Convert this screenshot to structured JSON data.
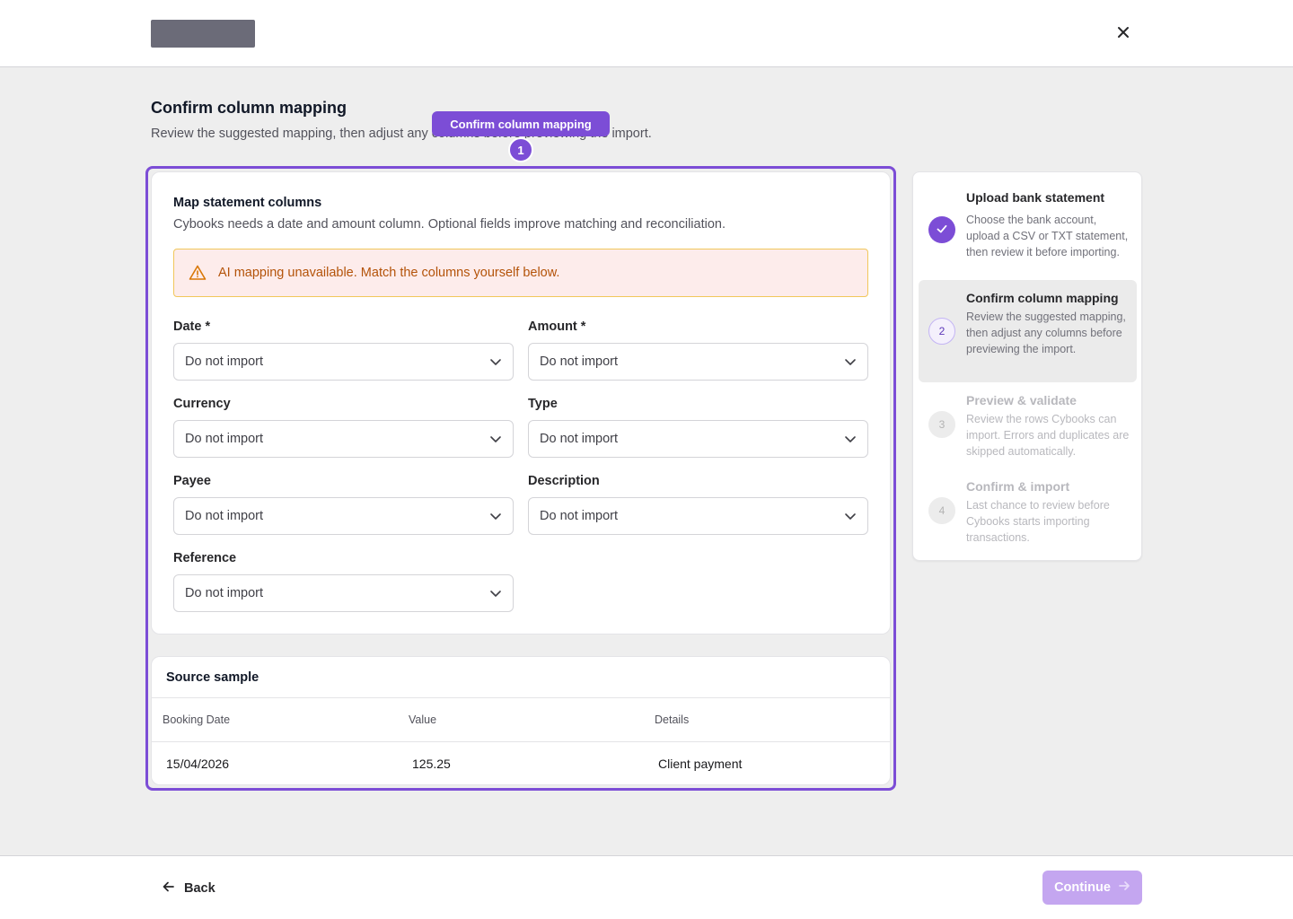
{
  "header": {
    "close_icon": "close-icon"
  },
  "page": {
    "title": "Confirm column mapping",
    "subtitle": "Review the suggested mapping, then adjust any columns before previewing the import."
  },
  "tour": {
    "label": "Confirm column mapping",
    "step_number": "1",
    "accent": "#7c4dd6"
  },
  "mapping": {
    "title": "Map statement columns",
    "description": "Cybooks needs a date and amount column. Optional fields improve matching and reconciliation.",
    "alert": {
      "icon": "warning-icon",
      "text": "AI mapping unavailable. Match the columns yourself below.",
      "color": "#b45309"
    },
    "fields": {
      "date": {
        "label": "Date *",
        "value": "Do not import"
      },
      "amount": {
        "label": "Amount *",
        "value": "Do not import"
      },
      "currency": {
        "label": "Currency",
        "value": "Do not import"
      },
      "type": {
        "label": "Type",
        "value": "Do not import"
      },
      "payee": {
        "label": "Payee",
        "value": "Do not import"
      },
      "description": {
        "label": "Description",
        "value": "Do not import"
      },
      "reference": {
        "label": "Reference",
        "value": "Do not import"
      }
    }
  },
  "sample": {
    "title": "Source sample",
    "columns": [
      "Booking Date",
      "Value",
      "Details"
    ],
    "rows": [
      [
        "15/04/2026",
        "125.25",
        "Client payment"
      ]
    ]
  },
  "steps": [
    {
      "number": "1",
      "status": "done",
      "title": "Upload bank statement",
      "description": "Choose the bank account, upload a CSV or TXT statement, then review it before importing."
    },
    {
      "number": "2",
      "status": "current",
      "title": "Confirm column mapping",
      "description": "Review the suggested mapping, then adjust any columns before previewing the import."
    },
    {
      "number": "3",
      "status": "upcoming",
      "title": "Preview & validate",
      "description": "Review the rows Cybooks can import. Errors and duplicates are skipped automatically."
    },
    {
      "number": "4",
      "status": "upcoming",
      "title": "Confirm & import",
      "description": "Last chance to review before Cybooks starts importing transactions."
    }
  ],
  "footer": {
    "back_label": "Back",
    "continue_label": "Continue",
    "continue_color": "#c4a6f0"
  }
}
